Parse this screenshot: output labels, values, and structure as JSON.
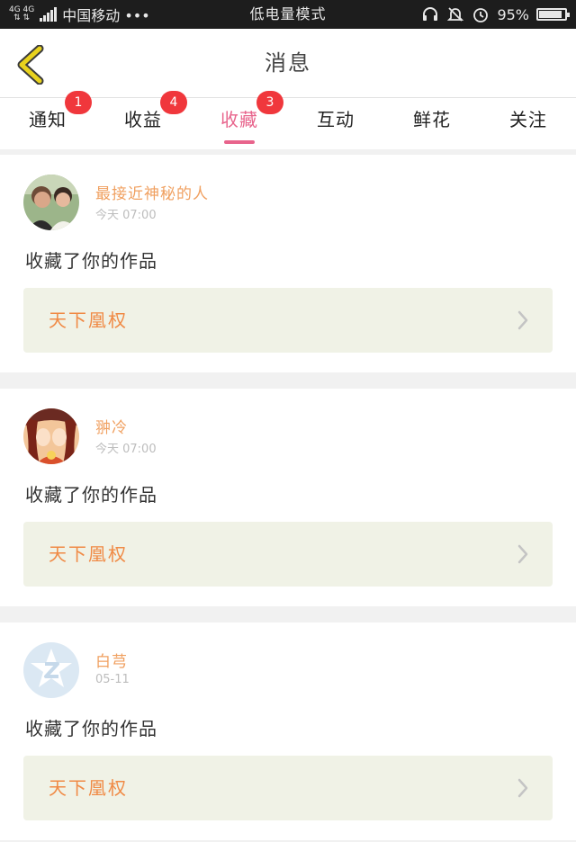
{
  "status_bar": {
    "net_top": "4G 4G",
    "net_bottom": "⇅ ⇅",
    "carrier": "中国移动 •••",
    "mode": "低电量模式",
    "battery_percent": "95%",
    "battery_level": 0.95
  },
  "header": {
    "title": "消息"
  },
  "tabs": [
    {
      "label": "通知",
      "badge": "1"
    },
    {
      "label": "收益",
      "badge": "4"
    },
    {
      "label": "收藏",
      "badge": "3",
      "active": true
    },
    {
      "label": "互动",
      "badge": ""
    },
    {
      "label": "鲜花",
      "badge": ""
    },
    {
      "label": "关注",
      "badge": ""
    }
  ],
  "messages": [
    {
      "user": "最接近神秘的人",
      "time": "今天 07:00",
      "action": "收藏了你的作品",
      "work_title": "天下凰权"
    },
    {
      "user": "翀冷",
      "time": "今天 07:00",
      "action": "收藏了你的作品",
      "work_title": "天下凰权"
    },
    {
      "user": "白芎",
      "time": "05-11",
      "action": "收藏了你的作品",
      "work_title": "天下凰权"
    }
  ],
  "colors": {
    "accent": "#e8648c",
    "badge": "#f0373c",
    "username": "#f0a060",
    "work_title": "#f08a45",
    "work_bg": "#f0f2e6",
    "back_arrow": "#e8d21e"
  },
  "icons": [
    "back-arrow-icon",
    "headset-icon",
    "bell-muted-icon",
    "alarm-icon",
    "battery-icon",
    "chevron-right-icon"
  ]
}
